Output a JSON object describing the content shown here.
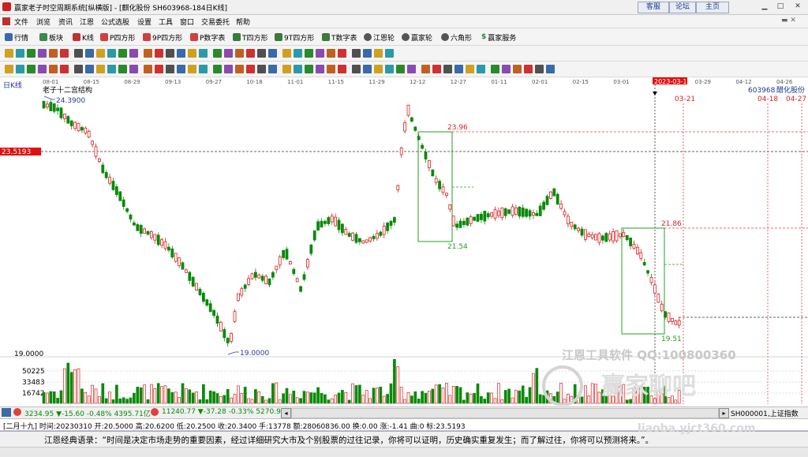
{
  "window": {
    "title": "赢家老子时空周期系统[纵横版] - [麒化股份  SH603968-184日K线]",
    "buttons": [
      "客服",
      "论坛",
      "主页"
    ]
  },
  "menu": [
    "文件",
    "浏览",
    "资讯",
    "江恩",
    "公式选股",
    "设置",
    "工具",
    "窗口",
    "交易委托",
    "帮助"
  ],
  "toolbar": [
    "行情",
    "板块",
    "K线",
    "P四方形",
    "9P四方形",
    "P数字表",
    "T四方形",
    "9T四方形",
    "T数字表",
    "江恩轮",
    "赢家轮",
    "六角形",
    "赢家服务"
  ],
  "chart": {
    "period_label": "日K线",
    "structure_label": "老子十二宫结构",
    "stock_code": "603968",
    "stock_name": "醋化股份",
    "current_price_tag": "23.5193",
    "highlight_date": "2023-03-10",
    "dates": [
      "08-01",
      "08-15",
      "08-29",
      "09-13",
      "09-27",
      "10-18",
      "11-01",
      "11-15",
      "11-29",
      "12-12",
      "12-27",
      "01-11",
      "02-01",
      "02-15",
      "03-01",
      "2023-03-10",
      "03-29",
      "04-12",
      "04-26"
    ],
    "future_dates": [
      "03-21",
      "04-18",
      "04-27"
    ],
    "annotations": {
      "high": "24.3900",
      "low": "19.0000",
      "box1_top": "23.96",
      "box1_bottom": "21.54",
      "box2_top": "21.86",
      "box2_bottom": "19.51"
    },
    "price_axis_label": "19.0000",
    "volume_axis": [
      "50225",
      "33483",
      "16742"
    ]
  },
  "watermark": {
    "line1": "江恩工具软件  QQ:100800360",
    "line2": "赢家聊吧",
    "line3": "liaoba.yjct360.com"
  },
  "index_bar": {
    "sh": "3234.95 ▼-15.60 -0.48% 4395.71亿",
    "sz": "11240.77 ▼-37.28 -0.33% 5270.95",
    "code": "SH000001,上证指数"
  },
  "info_bar": "[二月十九] 时间:20230310 开:20.5000 高:20.6200 低:20.2500 收:20.3400 手:13778 额:28060836.00 换:0.00 涨:-1.41 曲:0 标:23.5193",
  "quote": "江恩经典语录：“时间是决定市场走势的重要因素，经过详细研究大市及个别股票的过往记录，你将可以证明，历史确实重复发生；而了解过往，你将可以预测将来。”。",
  "colors": {
    "up": "#dd2020",
    "down": "#0a8a0a",
    "accent": "#1a3a8a"
  }
}
